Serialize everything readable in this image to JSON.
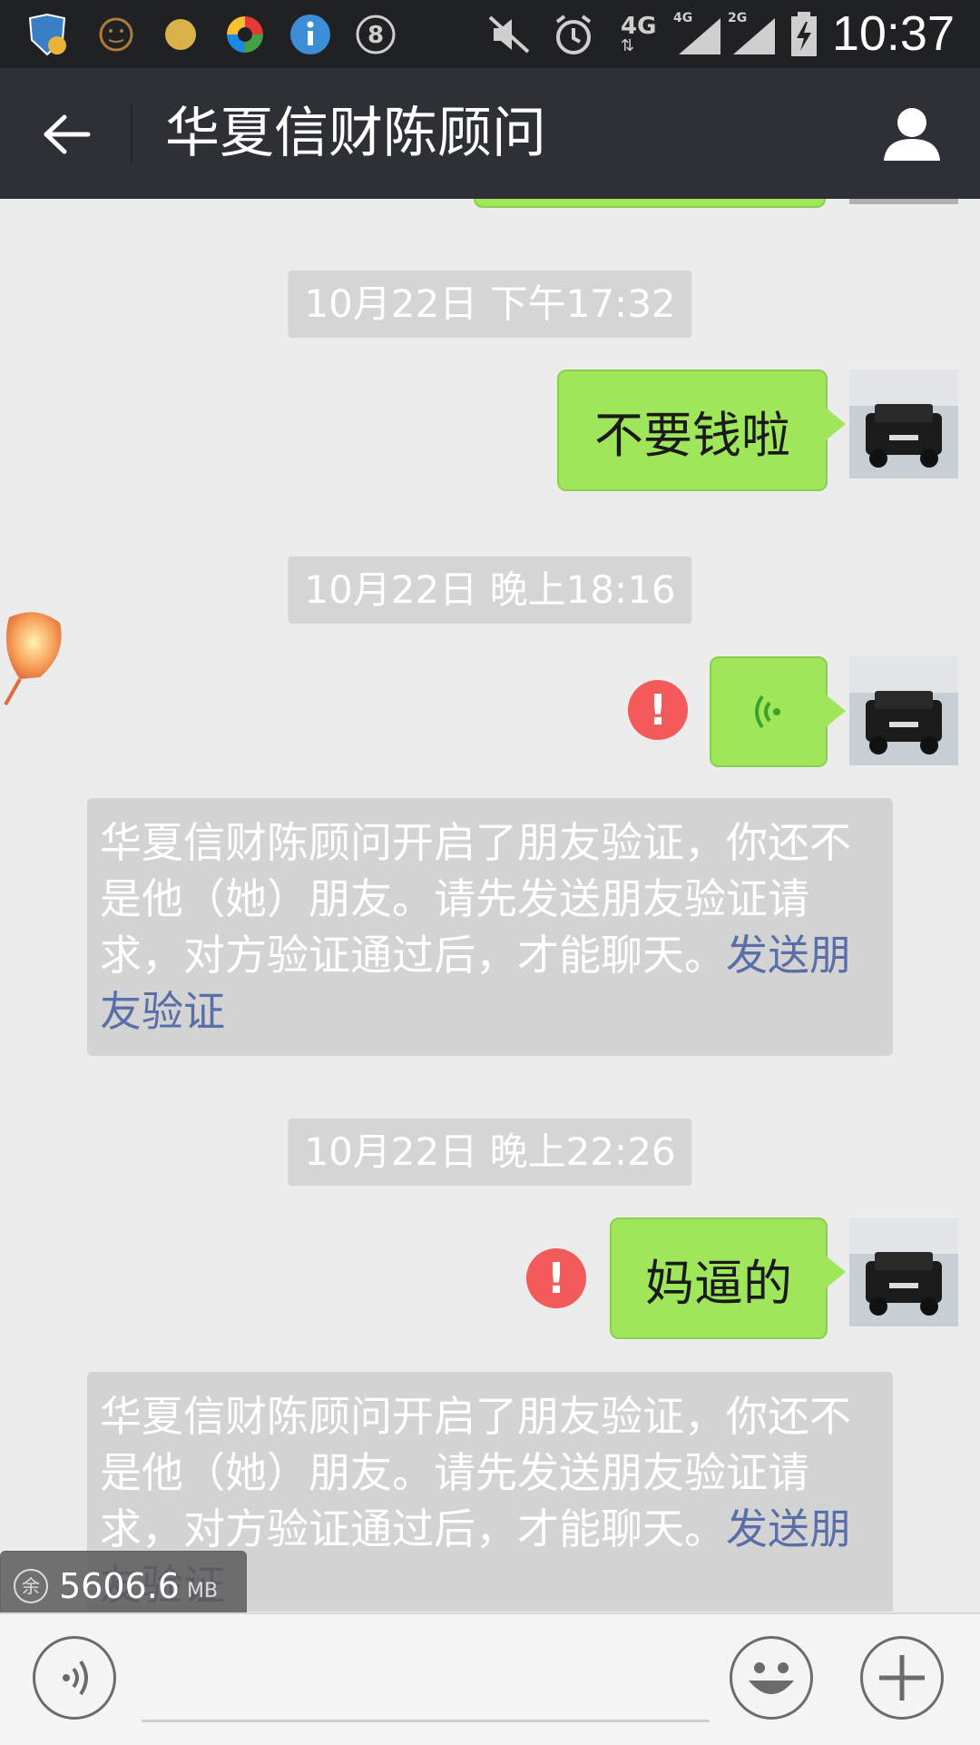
{
  "status_bar": {
    "time": "10:37",
    "icons": [
      "shield-icon",
      "emoji-status-icon",
      "yellow-dot-icon",
      "colorful-app-icon",
      "info-icon",
      "eight-icon",
      "mute-icon",
      "alarm-icon",
      "signal-4g-icon",
      "signal-4g-bars-icon",
      "signal-2g-bars-icon",
      "battery-charging-icon"
    ],
    "network_labels": [
      "4G",
      "4G",
      "2G"
    ]
  },
  "header": {
    "title": "华夏信财陈顾问"
  },
  "messages": {
    "ts1": "10月22日 下午17:32",
    "msg1": "不要钱啦",
    "ts2": "10月22日 晚上18:16",
    "sys1_text": "华夏信财陈顾问开启了朋友验证，你还不是他（她）朋友。请先发送朋友验证请求，对方验证通过后，才能聊天。",
    "sys1_link": "发送朋友验证",
    "ts3": "10月22日 晚上22:26",
    "msg3": "妈逼的",
    "sys2_text": "华夏信财陈顾问开启了朋友验证，你还不是他（她）朋友。请先发送朋友验证请求，对方验证通过后，才能聊天。",
    "sys2_link": "发送朋友验证",
    "error_mark": "!"
  },
  "memory_overlay": {
    "label": "余",
    "value": "5606.6",
    "unit": "MB"
  },
  "colors": {
    "bubble_green": "#9fe65a",
    "error_red": "#f35a5a",
    "link_blue": "#5a6fa8",
    "header_bg": "#2d3135"
  }
}
